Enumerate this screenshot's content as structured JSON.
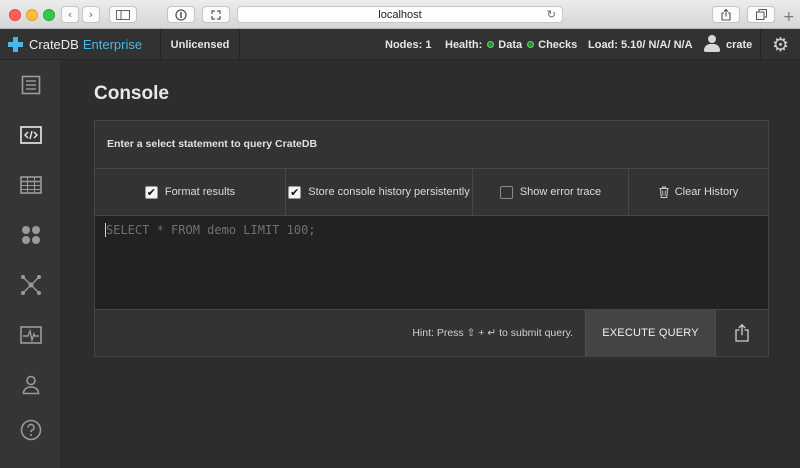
{
  "browser": {
    "url": "localhost",
    "back_glyph": "‹",
    "forward_glyph": "›",
    "reload_glyph": "↻",
    "new_tab_glyph": "+"
  },
  "header": {
    "brand_name": "CrateDB",
    "brand_edition": "Enterprise",
    "license": "Unlicensed",
    "nodes": "Nodes: 1",
    "health_label": "Health:",
    "health_data": "Data",
    "health_checks": "Checks",
    "load": "Load: 5.10/ N/A/ N/A",
    "user": "crate"
  },
  "sidebar": {
    "items": [
      {
        "icon": "overview-icon"
      },
      {
        "icon": "console-icon",
        "active": true
      },
      {
        "icon": "tables-icon"
      },
      {
        "icon": "views-icon"
      },
      {
        "icon": "cluster-icon"
      },
      {
        "icon": "monitoring-icon"
      },
      {
        "icon": "users-icon"
      },
      {
        "icon": "help-icon"
      }
    ]
  },
  "console": {
    "title": "Console",
    "prompt": "Enter a select statement to query CrateDB",
    "options": {
      "format_results": "Format results",
      "format_results_checked": true,
      "store_history": "Store console history persistently",
      "store_history_checked": true,
      "error_trace": "Show error trace",
      "error_trace_checked": false,
      "clear_history": "Clear History"
    },
    "check_glyph": "✔",
    "query_placeholder": "SELECT * FROM demo LIMIT 100;",
    "hint": "Hint: Press ⇧ + ↵ to submit query.",
    "execute_label": "EXECUTE QUERY"
  },
  "colors": {
    "accent": "#49b8e6",
    "health_ok": "#5fd25f",
    "background": "#2d2d2d"
  }
}
